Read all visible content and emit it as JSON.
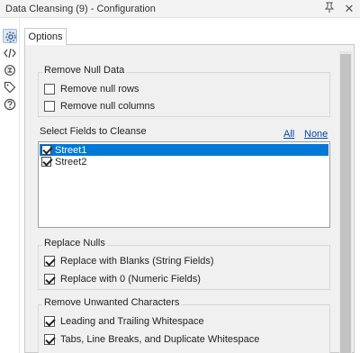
{
  "window": {
    "title": "Data Cleansing (9) - Configuration",
    "pin_icon": "pin-icon",
    "close_icon": "close-icon"
  },
  "sidebar": {
    "overflow_label": "...",
    "icons": [
      "gear-icon",
      "code-icon",
      "workflow-icon",
      "tag-icon",
      "help-icon"
    ]
  },
  "tabs": [
    {
      "label": "Options",
      "active": true
    }
  ],
  "remove_null_data": {
    "title": "Remove Null Data",
    "options": [
      {
        "label": "Remove null rows",
        "checked": false
      },
      {
        "label": "Remove null columns",
        "checked": false
      }
    ]
  },
  "fields": {
    "title": "Select Fields to Cleanse",
    "all_label": "All",
    "none_label": "None",
    "items": [
      {
        "label": "Street1",
        "checked": true,
        "selected": true
      },
      {
        "label": "Street2",
        "checked": true,
        "selected": false
      }
    ]
  },
  "replace_nulls": {
    "title": "Replace Nulls",
    "options": [
      {
        "label": "Replace with Blanks (String Fields)",
        "checked": true
      },
      {
        "label": "Replace with 0 (Numeric Fields)",
        "checked": true
      }
    ]
  },
  "remove_unwanted": {
    "title": "Remove Unwanted Characters",
    "options": [
      {
        "label": "Leading and Trailing Whitespace",
        "checked": true
      },
      {
        "label": "Tabs, Line Breaks, and Duplicate Whitespace",
        "checked": true
      }
    ]
  },
  "colors": {
    "selection": "#0078d7",
    "link": "#0645ad",
    "panel_bg": "#f0f0f0"
  }
}
